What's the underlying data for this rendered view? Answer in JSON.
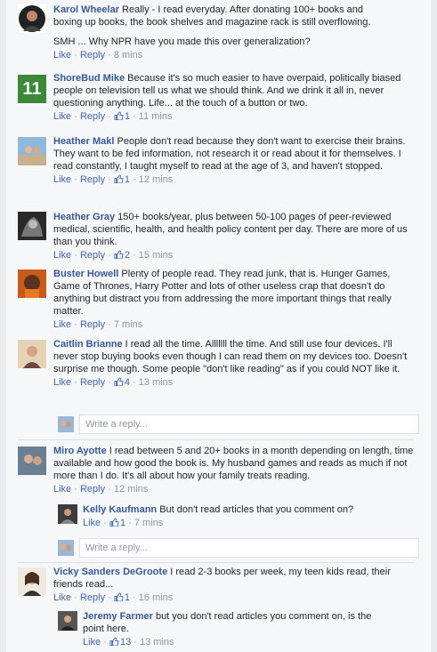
{
  "colors": {
    "link": "#365899",
    "action": "#4267b2",
    "meta": "#90949c",
    "text": "#1d2129",
    "background": "#f6f7f9"
  },
  "comments": [
    {
      "name": "Karol Wheelar",
      "text": " Really - I read everyday. After donating 100+ books and boxing up books, the book shelves and magazine rack is still overflowing.",
      "text2": "SMH ... Why NPR have you made this over generalization?",
      "like": "Like",
      "reply": "Reply",
      "likes": "",
      "time": "8 mins"
    },
    {
      "name": "ShoreBud Mike",
      "text": " Because it's so much easier to have overpaid, politically biased people on television tell us what we should think. And we drink it all in, never questioning anything. Life... at the touch of a button or two.",
      "avatar_text": "11",
      "like": "Like",
      "reply": "Reply",
      "likes": "1",
      "time": "11 mins"
    },
    {
      "name": "Heather Makl",
      "text": " People don't read because they don't want to exercise their brains. They want to be fed information, not research it or read about it for themselves. I read constantly, I taught myself to read at the age of 3, and haven't stopped.",
      "like": "Like",
      "reply": "Reply",
      "likes": "1",
      "time": "12 mins"
    },
    {
      "name": "Heather Gray",
      "text": " 150+ books/year, plus between 50-100 pages of peer-reviewed medical, scientific, health, and health policy content per day. There are more of us than you think.",
      "like": "Like",
      "reply": "Reply",
      "likes": "2",
      "time": "15 mins"
    },
    {
      "name": "Buster Howell",
      "text": " Plenty of people read. They read junk, that is. Hunger Games, Game of Thrones, Harry Potter and lots of other useless crap that doesn't do anything but distract you from addressing the more important things that really matter.",
      "like": "Like",
      "reply": "Reply",
      "likes": "",
      "time": "7 mins"
    },
    {
      "name": "Caitlin Brianne",
      "text": " I read all the time. Alllllll the time. And still use four devices. I'll never stop buying books even though I can read them on my devices too. Doesn't surprise me though. Some people \"don't like reading\" as if you could NOT like it.",
      "like": "Like",
      "reply": "Reply",
      "likes": "4",
      "time": "13 mins"
    },
    {
      "name": "Miro Ayotte",
      "text": " I read between 5 and 20+ books in a month depending on length, time available and how good the book is. My husband games and reads as much if not more than I do. It's all about how your family treats reading.",
      "like": "Like",
      "reply": "Reply",
      "likes": "",
      "time": "12 mins"
    },
    {
      "name": "Kelly Kaufmann",
      "text": " But don't read articles that you comment on?",
      "like": "Like",
      "likes": "1",
      "time": "7 mins"
    },
    {
      "name": "Vicky Sanders DeGroote",
      "text": " I read 2-3 books per week, my teen kids read, their friends read...",
      "like": "Like",
      "reply": "Reply",
      "likes": "1",
      "time": "16 mins"
    },
    {
      "name": "Jeremy Farmer",
      "text": " but you don't read articles you comment on, is the point here.",
      "like": "Like",
      "likes": "13",
      "time": "13 mins"
    }
  ],
  "reply_box": {
    "placeholder": "Write a reply..."
  }
}
